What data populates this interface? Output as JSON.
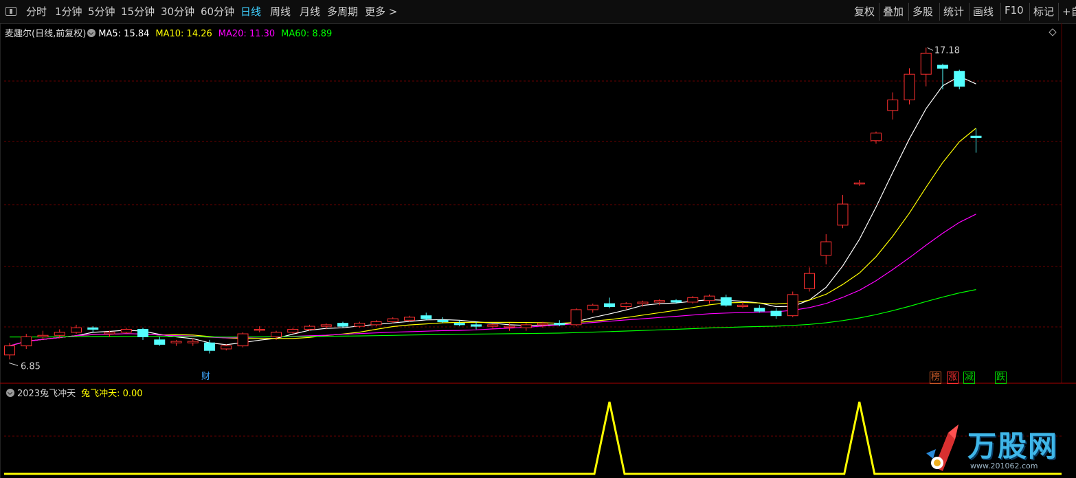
{
  "toolbar": {
    "periods": [
      "分时",
      "1分钟",
      "5分钟",
      "15分钟",
      "30分钟",
      "60分钟",
      "日线",
      "周线",
      "月线",
      "多周期",
      "更多 >"
    ],
    "active_period": "日线",
    "right_buttons": [
      "复权",
      "叠加",
      "多股",
      "统计",
      "画线",
      "F10",
      "标记",
      "+自"
    ]
  },
  "main_legend": {
    "stock": "麦趣尔(日线,前复权)",
    "ma": [
      {
        "label": "MA5: 15.84",
        "color": "#ffffff"
      },
      {
        "label": "MA10: 14.26",
        "color": "#ffff00"
      },
      {
        "label": "MA20: 11.30",
        "color": "#ff00ff"
      },
      {
        "label": "MA60: 8.89",
        "color": "#00ff00"
      }
    ]
  },
  "high_label": "17.18",
  "low_label": "6.85",
  "finance_badge": "财",
  "event_badges": [
    {
      "label": "榜",
      "color": "#c85a28"
    },
    {
      "label": "涨",
      "color": "#ff3030"
    },
    {
      "label": "减",
      "color": "#00cc00"
    },
    {
      "label": "跌",
      "color": "#00cc00"
    }
  ],
  "indicator_legend": {
    "name": "2023兔飞冲天",
    "value": "兔飞冲天: 0.00",
    "value_color": "#ffff00"
  },
  "watermark": {
    "text": "万股网",
    "url": "www.201062.com"
  },
  "colors": {
    "up": "#ff3030",
    "down": "#54ffff",
    "grid": "#6a0000"
  },
  "chart_data": {
    "type": "candlestick",
    "price_range": [
      6.85,
      17.18
    ],
    "candles": [
      {
        "o": 7.0,
        "h": 7.4,
        "l": 6.85,
        "c": 7.3
      },
      {
        "o": 7.3,
        "h": 7.7,
        "l": 7.2,
        "c": 7.6
      },
      {
        "o": 7.6,
        "h": 7.8,
        "l": 7.5,
        "c": 7.65
      },
      {
        "o": 7.65,
        "h": 7.85,
        "l": 7.55,
        "c": 7.75
      },
      {
        "o": 7.75,
        "h": 8.0,
        "l": 7.7,
        "c": 7.9
      },
      {
        "o": 7.9,
        "h": 7.95,
        "l": 7.75,
        "c": 7.85
      },
      {
        "o": 7.7,
        "h": 7.8,
        "l": 7.6,
        "c": 7.75
      },
      {
        "o": 7.75,
        "h": 7.9,
        "l": 7.7,
        "c": 7.85
      },
      {
        "o": 7.85,
        "h": 7.9,
        "l": 7.5,
        "c": 7.6
      },
      {
        "o": 7.5,
        "h": 7.6,
        "l": 7.3,
        "c": 7.35
      },
      {
        "o": 7.4,
        "h": 7.5,
        "l": 7.3,
        "c": 7.45
      },
      {
        "o": 7.4,
        "h": 7.55,
        "l": 7.3,
        "c": 7.45
      },
      {
        "o": 7.4,
        "h": 7.5,
        "l": 7.05,
        "c": 7.15
      },
      {
        "o": 7.2,
        "h": 7.35,
        "l": 7.15,
        "c": 7.3
      },
      {
        "o": 7.3,
        "h": 7.75,
        "l": 7.25,
        "c": 7.7
      },
      {
        "o": 7.85,
        "h": 7.95,
        "l": 7.75,
        "c": 7.85
      },
      {
        "o": 7.6,
        "h": 7.8,
        "l": 7.5,
        "c": 7.75
      },
      {
        "o": 7.75,
        "h": 7.9,
        "l": 7.7,
        "c": 7.85
      },
      {
        "o": 7.85,
        "h": 8.0,
        "l": 7.8,
        "c": 7.95
      },
      {
        "o": 7.95,
        "h": 8.05,
        "l": 7.85,
        "c": 8.0
      },
      {
        "o": 8.05,
        "h": 8.1,
        "l": 7.9,
        "c": 7.95
      },
      {
        "o": 7.95,
        "h": 8.1,
        "l": 7.9,
        "c": 8.05
      },
      {
        "o": 8.0,
        "h": 8.15,
        "l": 7.95,
        "c": 8.1
      },
      {
        "o": 8.1,
        "h": 8.25,
        "l": 8.05,
        "c": 8.2
      },
      {
        "o": 8.15,
        "h": 8.3,
        "l": 8.1,
        "c": 8.25
      },
      {
        "o": 8.3,
        "h": 8.4,
        "l": 8.15,
        "c": 8.2
      },
      {
        "o": 8.15,
        "h": 8.25,
        "l": 8.05,
        "c": 8.1
      },
      {
        "o": 8.05,
        "h": 8.15,
        "l": 7.95,
        "c": 8.0
      },
      {
        "o": 8.0,
        "h": 8.1,
        "l": 7.85,
        "c": 7.95
      },
      {
        "o": 7.95,
        "h": 8.05,
        "l": 7.85,
        "c": 8.0
      },
      {
        "o": 7.95,
        "h": 8.05,
        "l": 7.8,
        "c": 7.95
      },
      {
        "o": 7.9,
        "h": 8.05,
        "l": 7.8,
        "c": 8.0
      },
      {
        "o": 8.0,
        "h": 8.1,
        "l": 7.9,
        "c": 8.05
      },
      {
        "o": 8.05,
        "h": 8.15,
        "l": 7.95,
        "c": 8.0
      },
      {
        "o": 8.0,
        "h": 8.55,
        "l": 7.95,
        "c": 8.5
      },
      {
        "o": 8.5,
        "h": 8.7,
        "l": 8.4,
        "c": 8.65
      },
      {
        "o": 8.7,
        "h": 8.9,
        "l": 8.55,
        "c": 8.6
      },
      {
        "o": 8.6,
        "h": 8.75,
        "l": 8.5,
        "c": 8.7
      },
      {
        "o": 8.7,
        "h": 8.8,
        "l": 8.6,
        "c": 8.75
      },
      {
        "o": 8.75,
        "h": 8.85,
        "l": 8.65,
        "c": 8.8
      },
      {
        "o": 8.8,
        "h": 8.85,
        "l": 8.7,
        "c": 8.75
      },
      {
        "o": 8.75,
        "h": 8.95,
        "l": 8.7,
        "c": 8.9
      },
      {
        "o": 8.8,
        "h": 9.0,
        "l": 8.7,
        "c": 8.95
      },
      {
        "o": 8.9,
        "h": 9.0,
        "l": 8.6,
        "c": 8.65
      },
      {
        "o": 8.6,
        "h": 8.75,
        "l": 8.55,
        "c": 8.65
      },
      {
        "o": 8.55,
        "h": 8.65,
        "l": 8.4,
        "c": 8.45
      },
      {
        "o": 8.45,
        "h": 8.55,
        "l": 8.2,
        "c": 8.3
      },
      {
        "o": 8.3,
        "h": 9.1,
        "l": 8.25,
        "c": 9.0
      },
      {
        "o": 9.2,
        "h": 9.9,
        "l": 9.1,
        "c": 9.7
      },
      {
        "o": 10.3,
        "h": 11.0,
        "l": 10.0,
        "c": 10.75
      },
      {
        "o": 11.3,
        "h": 12.3,
        "l": 11.2,
        "c": 12.0
      },
      {
        "o": 12.7,
        "h": 12.8,
        "l": 12.6,
        "c": 12.7
      },
      {
        "o": 14.1,
        "h": 14.4,
        "l": 14.0,
        "c": 14.35
      },
      {
        "o": 15.1,
        "h": 15.7,
        "l": 14.8,
        "c": 15.45
      },
      {
        "o": 15.45,
        "h": 16.5,
        "l": 15.3,
        "c": 16.3
      },
      {
        "o": 16.3,
        "h": 17.18,
        "l": 15.9,
        "c": 17.0
      },
      {
        "o": 16.6,
        "h": 16.65,
        "l": 15.8,
        "c": 16.5
      },
      {
        "o": 16.4,
        "h": 16.45,
        "l": 15.8,
        "c": 15.9
      },
      {
        "o": 14.25,
        "h": 14.5,
        "l": 13.7,
        "c": 14.2
      }
    ],
    "indicator": {
      "name": "兔飞冲天",
      "signal_days": [
        36,
        51
      ]
    }
  }
}
